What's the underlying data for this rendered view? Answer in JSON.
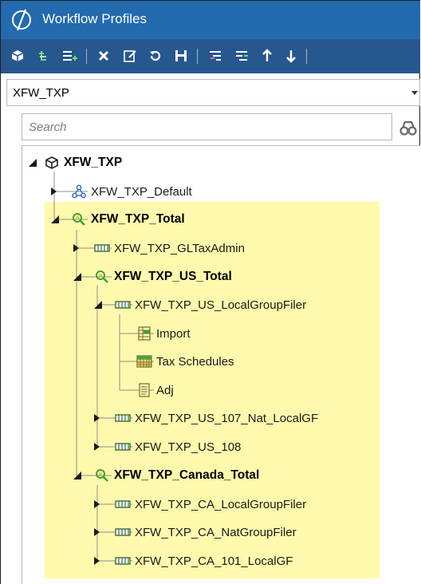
{
  "window": {
    "title": "Workflow Profiles"
  },
  "toolbar": {
    "buttons": [
      {
        "name": "cube-icon"
      },
      {
        "name": "add-child-icon"
      },
      {
        "name": "add-sibling-icon"
      },
      {
        "name": "delete-icon"
      },
      {
        "name": "rename-icon"
      },
      {
        "name": "refresh-icon"
      },
      {
        "name": "save-icon"
      },
      {
        "name": "collapse-icon"
      },
      {
        "name": "expand-icon"
      },
      {
        "name": "move-up-icon"
      },
      {
        "name": "move-down-icon"
      }
    ]
  },
  "profile_selector": {
    "value": "XFW_TXP"
  },
  "search": {
    "placeholder": "Search"
  },
  "tree": {
    "root": {
      "label": "XFW_TXP",
      "icon": "cube-icon"
    },
    "nodes": [
      {
        "label": "XFW_TXP_Default",
        "icon": "hierarchy-icon",
        "bold": false
      },
      {
        "label": "XFW_TXP_Total",
        "icon": "review-icon",
        "bold": true
      },
      {
        "label": "XFW_TXP_GLTaxAdmin",
        "icon": "base-input-icon",
        "bold": false
      },
      {
        "label": "XFW_TXP_US_Total",
        "icon": "review-icon",
        "bold": true
      },
      {
        "label": "XFW_TXP_US_LocalGroupFiler",
        "icon": "base-input-icon",
        "bold": false
      },
      {
        "label": "Import",
        "icon": "import-icon",
        "bold": false
      },
      {
        "label": "Tax Schedules",
        "icon": "schedule-grid-icon",
        "bold": false
      },
      {
        "label": "Adj",
        "icon": "journal-icon",
        "bold": false
      },
      {
        "label": "XFW_TXP_US_107_Nat_LocalGF",
        "icon": "base-input-icon",
        "bold": false
      },
      {
        "label": "XFW_TXP_US_108",
        "icon": "base-input-icon",
        "bold": false
      },
      {
        "label": "XFW_TXP_Canada_Total",
        "icon": "review-icon",
        "bold": true
      },
      {
        "label": "XFW_TXP_CA_LocalGroupFiler",
        "icon": "base-input-icon",
        "bold": false
      },
      {
        "label": "XFW_TXP_CA_NatGroupFiler",
        "icon": "base-input-icon",
        "bold": false
      },
      {
        "label": "XFW_TXP_CA_101_LocalGF",
        "icon": "base-input-icon",
        "bold": false
      }
    ]
  },
  "colors": {
    "titlebar": "#236aaf",
    "toolbar": "#27578f",
    "highlight": "#fff9ad"
  }
}
